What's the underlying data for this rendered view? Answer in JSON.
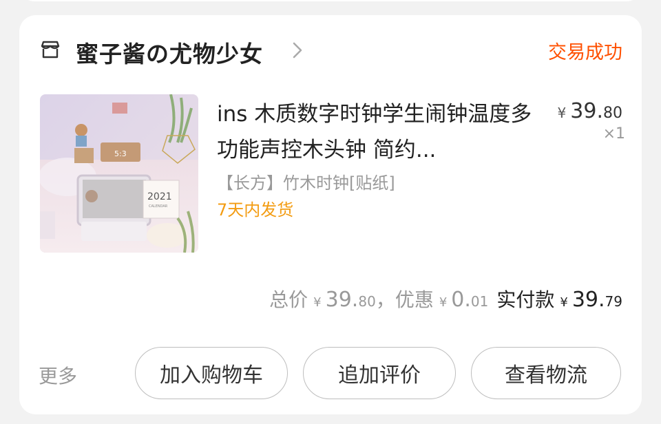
{
  "shop": {
    "name": "蜜子酱の尤物少女",
    "status": "交易成功"
  },
  "product": {
    "title": "ins 木质数字时钟学生闹钟温度多功能声控木头钟 简约...",
    "price_currency": "¥",
    "price_integer": "39.",
    "price_decimal": "80",
    "quantity": "×1",
    "sku": "【长方】竹木时钟[贴纸]",
    "shipping": "7天内发货",
    "image": {
      "calendar_year": "2021",
      "calendar_caption": "CALENDAR"
    }
  },
  "summary": {
    "total_label": "总价",
    "total_currency": "¥",
    "total_integer": "39.",
    "total_decimal": "80",
    "separator": "，",
    "discount_label": "优惠",
    "discount_currency": "¥",
    "discount_integer": "0.",
    "discount_decimal": "01",
    "paid_label": "实付款",
    "paid_currency": "¥",
    "paid_integer": "39.",
    "paid_decimal": "79"
  },
  "actions": {
    "more_label": "更多",
    "add_to_cart": "加入购物车",
    "add_review": "追加评价",
    "view_logistics": "查看物流"
  },
  "colors": {
    "accent": "#ff5000",
    "shipping": "#f39c12",
    "background": "#f2f2f2"
  },
  "icons": {
    "shop": "shop-icon",
    "chevron": "chevron-right-icon"
  }
}
